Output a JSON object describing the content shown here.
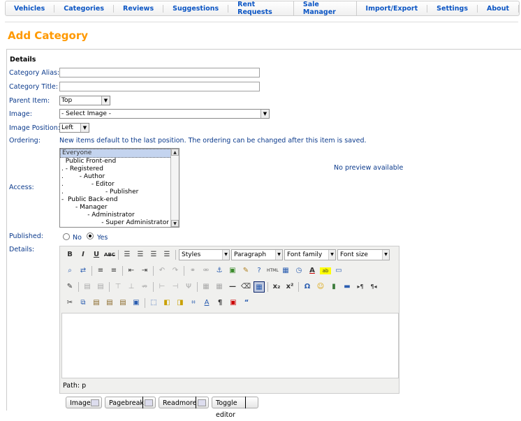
{
  "top_menu": [
    "Vehicles",
    "Categories",
    "Reviews",
    "Suggestions",
    "Rent Requests",
    "Sale Manager",
    "Import/Export",
    "Settings",
    "About"
  ],
  "page_title": "Add Category",
  "details_legend": "Details",
  "labels": {
    "alias": "Category Alias:",
    "title": "Category Title:",
    "parent": "Parent Item:",
    "image": "Image:",
    "image_position": "Image Position:",
    "ordering": "Ordering:",
    "access": "Access:",
    "published": "Published:",
    "details": "Details:"
  },
  "fields": {
    "alias_value": "",
    "title_value": "",
    "parent_value": "Top",
    "image_value": "- Select Image -",
    "image_position_value": "Left"
  },
  "ordering_note": "New items default to the last position. The ordering can be changed after this item is saved.",
  "preview_text": "No preview available",
  "access_options": [
    "Everyone",
    "  Public Front-end",
    ". - Registered",
    ".        - Author",
    ".              - Editor",
    ".                     - Publisher",
    "-  Public Back-end",
    "       - Manager",
    "             - Administrator",
    "                    - Super Administrator"
  ],
  "published": {
    "no": "No",
    "yes": "Yes",
    "selected": "yes"
  },
  "editor": {
    "styles": "Styles",
    "format": "Paragraph",
    "font_family": "Font family",
    "font_size": "Font size",
    "path": "Path: p"
  },
  "buttons": {
    "image": "Image",
    "pagebreak": "Pagebreak",
    "readmore": "Readmore",
    "toggle": "Toggle editor"
  }
}
